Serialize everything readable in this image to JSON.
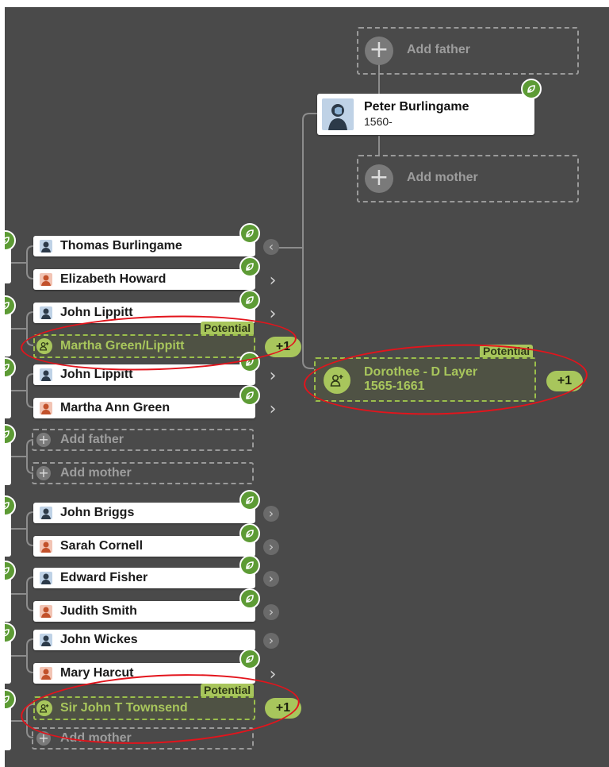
{
  "focus": {
    "name": "Peter Burlingame",
    "dates": "1560-"
  },
  "add_father_label": "Add father",
  "add_mother_label": "Add mother",
  "potential_label": "Potential",
  "plus_one": "+1",
  "spouse_potential": {
    "name": "Dorothee - D Layer",
    "dates": "1565-1661"
  },
  "children": [
    {
      "father": "Thomas Burlingame",
      "mother": "Elizabeth Howard"
    },
    {
      "father": "John Lippitt",
      "potential_mother": "Martha Green/Lippitt"
    },
    {
      "father": "John Lippitt",
      "mother": "Martha Ann Green"
    },
    {
      "add_father": "Add father",
      "add_mother": "Add mother"
    },
    {
      "father": "John Briggs",
      "mother": "Sarah Cornell"
    },
    {
      "father": "Edward Fisher",
      "mother": "Judith Smith"
    },
    {
      "father": "John Wickes",
      "mother": "Mary Harcut"
    },
    {
      "potential_father": "Sir John T Townsend",
      "add_mother": "Add mother"
    }
  ],
  "icons": {
    "leaf": "leaf-hint-icon",
    "chevron": "chevron-right-icon",
    "back": "chevron-left-icon",
    "plus": "plus-icon",
    "add_person": "add-person-icon",
    "avatar_male": "male-avatar-icon",
    "avatar_female": "female-avatar-icon"
  },
  "colors": {
    "background": "#4a4a4a",
    "leaf_green": "#5d9b35",
    "potential_green": "#a8c65c",
    "annotation_red": "#e3141c"
  }
}
